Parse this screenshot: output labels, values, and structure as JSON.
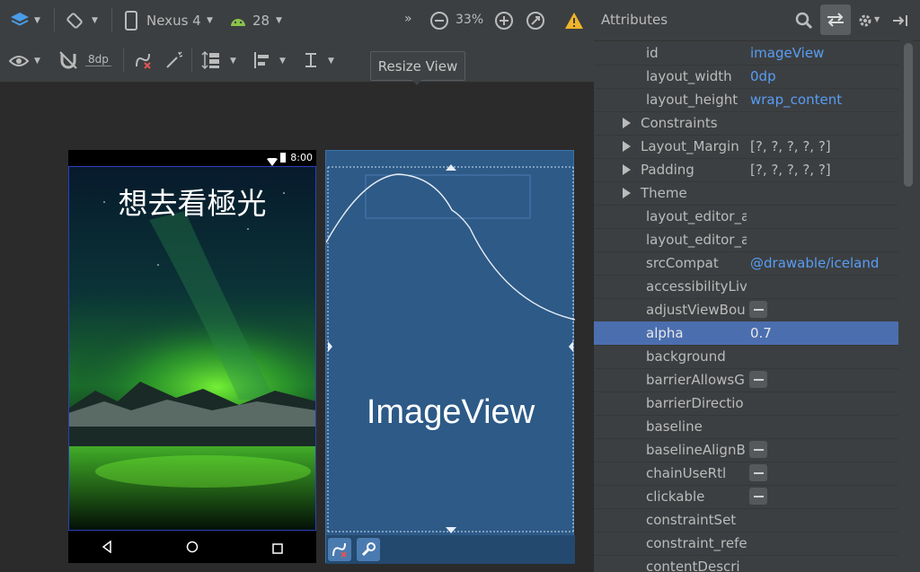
{
  "toolbar": {
    "device": "Nexus 4",
    "api_level": "28",
    "zoom": "33%",
    "margin_label": "8dp",
    "overflow": "»"
  },
  "tooltip": {
    "text": "Resize View"
  },
  "phone": {
    "time": "8:00",
    "title": "想去看極光"
  },
  "blueprint": {
    "label": "ImageView"
  },
  "attributes": {
    "title": "Attributes",
    "rows": [
      {
        "name": "id",
        "value": "imageView"
      },
      {
        "name": "layout_width",
        "value": "0dp"
      },
      {
        "name": "layout_height",
        "value": "wrap_content"
      },
      {
        "name": "Constraints",
        "value": ""
      },
      {
        "name": "Layout_Margin",
        "value": "[?, ?, ?, ?, ?]"
      },
      {
        "name": "Padding",
        "value": "[?, ?, ?, ?, ?]"
      },
      {
        "name": "Theme",
        "value": ""
      },
      {
        "name": "layout_editor_a",
        "value": ""
      },
      {
        "name": "layout_editor_a",
        "value": ""
      },
      {
        "name": "srcCompat",
        "value": "@drawable/iceland"
      },
      {
        "name": "accessibilityLive",
        "value": ""
      },
      {
        "name": "adjustViewBou",
        "value": ""
      },
      {
        "name": "alpha",
        "value": "0.7"
      },
      {
        "name": "background",
        "value": ""
      },
      {
        "name": "barrierAllowsG",
        "value": ""
      },
      {
        "name": "barrierDirectio",
        "value": ""
      },
      {
        "name": "baseline",
        "value": ""
      },
      {
        "name": "baselineAlignB",
        "value": ""
      },
      {
        "name": "chainUseRtl",
        "value": ""
      },
      {
        "name": "clickable",
        "value": ""
      },
      {
        "name": "constraintSet",
        "value": ""
      },
      {
        "name": "constraint_refe",
        "value": ""
      },
      {
        "name": "contentDescri",
        "value": ""
      }
    ]
  },
  "colors": {
    "accent": "#589df6",
    "selection": "#4b6eaf",
    "blueprint": "#2d5a87",
    "warning": "#f0b429"
  }
}
